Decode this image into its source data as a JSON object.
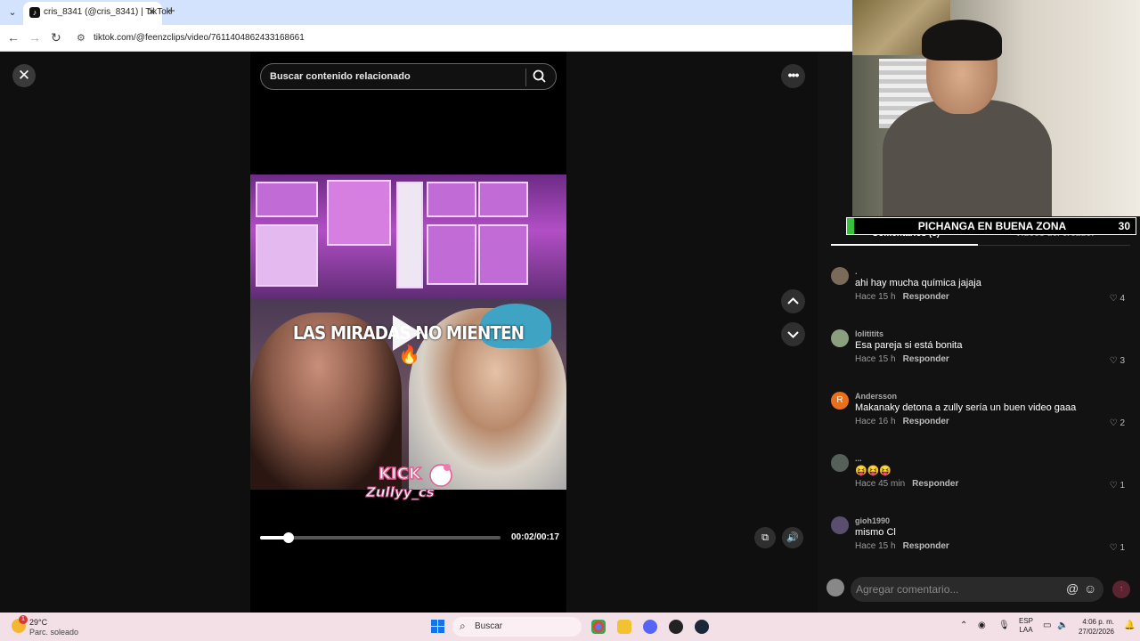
{
  "browser": {
    "tab_title": "cris_8341 (@cris_8341) | TikTok",
    "url": "tiktok.com/@feenzclips/video/7611404862433168661"
  },
  "video": {
    "search_placeholder": "Buscar contenido relacionado",
    "caption": "LAS MIRADAS NO MIENTEN",
    "overlay_logo_text": "KICK Zullyy_cs",
    "time": "00:02/00:17",
    "progress_fraction": 0.118
  },
  "panel": {
    "tabs": [
      {
        "label": "Comentarios (5)",
        "active": true
      },
      {
        "label": "Videos del creador",
        "active": false
      }
    ],
    "comments": [
      {
        "user": ".",
        "text": "ahi hay mucha química jajaja",
        "age": "Hace 15 h",
        "reply": "Responder",
        "likes": "4",
        "avatar_color": "#7a6a5a",
        "initial": ""
      },
      {
        "user": "lolititits",
        "text": "Esa pareja si está bonita",
        "age": "Hace 15 h",
        "reply": "Responder",
        "likes": "3",
        "avatar_color": "#8b9e7e",
        "initial": ""
      },
      {
        "user": "Andersson",
        "text": "Makanaky detona a zully sería un buen video gaaa",
        "age": "Hace 16 h",
        "reply": "Responder",
        "likes": "2",
        "avatar_color": "#e8701a",
        "initial": "R"
      },
      {
        "user": "...",
        "text": "😝😝😝",
        "age": "Hace 45 min",
        "reply": "Responder",
        "likes": "1",
        "avatar_color": "#55605a",
        "initial": ""
      },
      {
        "user": "gioh1990",
        "text": "mismo Cl",
        "age": "Hace 15 h",
        "reply": "Responder",
        "likes": "1",
        "avatar_color": "#5a4e6e",
        "initial": ""
      }
    ],
    "comment_placeholder": "Agregar comentario..."
  },
  "webcam": {
    "bar_title": "PICHANGA EN BUENA ZONA",
    "bar_number": "30"
  },
  "taskbar": {
    "temperature": "29°C",
    "weather": "Parc. soleado",
    "search_label": "Buscar",
    "lang_top": "ESP",
    "lang_bottom": "LAA",
    "time": "4:06 p. m.",
    "date": "27/02/2026",
    "weather_badge": "1"
  },
  "colors": {
    "accent": "#fe2c55",
    "windows_blue": "#1473e6"
  }
}
